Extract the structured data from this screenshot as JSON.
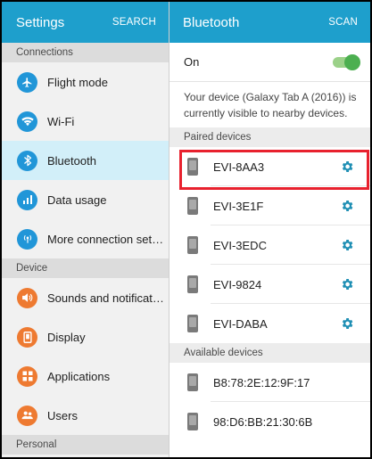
{
  "left_panel": {
    "header": {
      "title": "Settings",
      "action": "SEARCH"
    },
    "sections": [
      {
        "title": "Connections",
        "items": [
          {
            "label": "Flight mode",
            "icon": "airplane-icon",
            "color": "#2196d8"
          },
          {
            "label": "Wi-Fi",
            "icon": "wifi-icon",
            "color": "#2196d8"
          },
          {
            "label": "Bluetooth",
            "icon": "bluetooth-icon",
            "color": "#2196d8",
            "active": true
          },
          {
            "label": "Data usage",
            "icon": "data-usage-icon",
            "color": "#2196d8"
          },
          {
            "label": "More connection settings",
            "icon": "more-connections-icon",
            "color": "#2196d8"
          }
        ]
      },
      {
        "title": "Device",
        "items": [
          {
            "label": "Sounds and notifications",
            "icon": "volume-icon",
            "color": "#ee7a31"
          },
          {
            "label": "Display",
            "icon": "display-icon",
            "color": "#ee7a31"
          },
          {
            "label": "Applications",
            "icon": "applications-icon",
            "color": "#ee7a31"
          },
          {
            "label": "Users",
            "icon": "users-icon",
            "color": "#ee7a31"
          }
        ]
      },
      {
        "title": "Personal",
        "items": []
      }
    ]
  },
  "right_panel": {
    "header": {
      "title": "Bluetooth",
      "action": "SCAN"
    },
    "toggle": {
      "label": "On",
      "state": "on"
    },
    "description": "Your device (Galaxy Tab A (2016)) is currently visible to nearby devices.",
    "paired_title": "Paired devices",
    "paired": [
      {
        "name": "EVI-8AA3",
        "highlighted": true
      },
      {
        "name": "EVI-3E1F"
      },
      {
        "name": "EVI-3EDC"
      },
      {
        "name": "EVI-9824"
      },
      {
        "name": "EVI-DABA"
      }
    ],
    "available_title": "Available devices",
    "available": [
      {
        "name": "B8:78:2E:12:9F:17"
      },
      {
        "name": "98:D6:BB:21:30:6B"
      }
    ]
  },
  "colors": {
    "header": "#1e9fcc",
    "active_row": "#d2eff9",
    "connections_icon": "#2196d8",
    "device_icon": "#ee7a31",
    "gear": "#1f8fb4",
    "switch_on": "#4caf50",
    "highlight": "#e8212e"
  }
}
